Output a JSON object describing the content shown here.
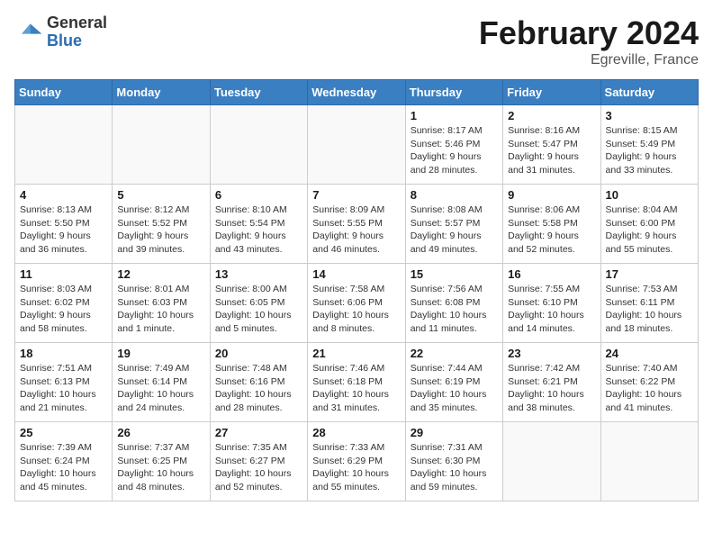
{
  "header": {
    "logo_line1": "General",
    "logo_line2": "Blue",
    "month_year": "February 2024",
    "location": "Egreville, France"
  },
  "days_of_week": [
    "Sunday",
    "Monday",
    "Tuesday",
    "Wednesday",
    "Thursday",
    "Friday",
    "Saturday"
  ],
  "weeks": [
    [
      {
        "day": "",
        "info": ""
      },
      {
        "day": "",
        "info": ""
      },
      {
        "day": "",
        "info": ""
      },
      {
        "day": "",
        "info": ""
      },
      {
        "day": "1",
        "info": "Sunrise: 8:17 AM\nSunset: 5:46 PM\nDaylight: 9 hours and 28 minutes."
      },
      {
        "day": "2",
        "info": "Sunrise: 8:16 AM\nSunset: 5:47 PM\nDaylight: 9 hours and 31 minutes."
      },
      {
        "day": "3",
        "info": "Sunrise: 8:15 AM\nSunset: 5:49 PM\nDaylight: 9 hours and 33 minutes."
      }
    ],
    [
      {
        "day": "4",
        "info": "Sunrise: 8:13 AM\nSunset: 5:50 PM\nDaylight: 9 hours and 36 minutes."
      },
      {
        "day": "5",
        "info": "Sunrise: 8:12 AM\nSunset: 5:52 PM\nDaylight: 9 hours and 39 minutes."
      },
      {
        "day": "6",
        "info": "Sunrise: 8:10 AM\nSunset: 5:54 PM\nDaylight: 9 hours and 43 minutes."
      },
      {
        "day": "7",
        "info": "Sunrise: 8:09 AM\nSunset: 5:55 PM\nDaylight: 9 hours and 46 minutes."
      },
      {
        "day": "8",
        "info": "Sunrise: 8:08 AM\nSunset: 5:57 PM\nDaylight: 9 hours and 49 minutes."
      },
      {
        "day": "9",
        "info": "Sunrise: 8:06 AM\nSunset: 5:58 PM\nDaylight: 9 hours and 52 minutes."
      },
      {
        "day": "10",
        "info": "Sunrise: 8:04 AM\nSunset: 6:00 PM\nDaylight: 9 hours and 55 minutes."
      }
    ],
    [
      {
        "day": "11",
        "info": "Sunrise: 8:03 AM\nSunset: 6:02 PM\nDaylight: 9 hours and 58 minutes."
      },
      {
        "day": "12",
        "info": "Sunrise: 8:01 AM\nSunset: 6:03 PM\nDaylight: 10 hours and 1 minute."
      },
      {
        "day": "13",
        "info": "Sunrise: 8:00 AM\nSunset: 6:05 PM\nDaylight: 10 hours and 5 minutes."
      },
      {
        "day": "14",
        "info": "Sunrise: 7:58 AM\nSunset: 6:06 PM\nDaylight: 10 hours and 8 minutes."
      },
      {
        "day": "15",
        "info": "Sunrise: 7:56 AM\nSunset: 6:08 PM\nDaylight: 10 hours and 11 minutes."
      },
      {
        "day": "16",
        "info": "Sunrise: 7:55 AM\nSunset: 6:10 PM\nDaylight: 10 hours and 14 minutes."
      },
      {
        "day": "17",
        "info": "Sunrise: 7:53 AM\nSunset: 6:11 PM\nDaylight: 10 hours and 18 minutes."
      }
    ],
    [
      {
        "day": "18",
        "info": "Sunrise: 7:51 AM\nSunset: 6:13 PM\nDaylight: 10 hours and 21 minutes."
      },
      {
        "day": "19",
        "info": "Sunrise: 7:49 AM\nSunset: 6:14 PM\nDaylight: 10 hours and 24 minutes."
      },
      {
        "day": "20",
        "info": "Sunrise: 7:48 AM\nSunset: 6:16 PM\nDaylight: 10 hours and 28 minutes."
      },
      {
        "day": "21",
        "info": "Sunrise: 7:46 AM\nSunset: 6:18 PM\nDaylight: 10 hours and 31 minutes."
      },
      {
        "day": "22",
        "info": "Sunrise: 7:44 AM\nSunset: 6:19 PM\nDaylight: 10 hours and 35 minutes."
      },
      {
        "day": "23",
        "info": "Sunrise: 7:42 AM\nSunset: 6:21 PM\nDaylight: 10 hours and 38 minutes."
      },
      {
        "day": "24",
        "info": "Sunrise: 7:40 AM\nSunset: 6:22 PM\nDaylight: 10 hours and 41 minutes."
      }
    ],
    [
      {
        "day": "25",
        "info": "Sunrise: 7:39 AM\nSunset: 6:24 PM\nDaylight: 10 hours and 45 minutes."
      },
      {
        "day": "26",
        "info": "Sunrise: 7:37 AM\nSunset: 6:25 PM\nDaylight: 10 hours and 48 minutes."
      },
      {
        "day": "27",
        "info": "Sunrise: 7:35 AM\nSunset: 6:27 PM\nDaylight: 10 hours and 52 minutes."
      },
      {
        "day": "28",
        "info": "Sunrise: 7:33 AM\nSunset: 6:29 PM\nDaylight: 10 hours and 55 minutes."
      },
      {
        "day": "29",
        "info": "Sunrise: 7:31 AM\nSunset: 6:30 PM\nDaylight: 10 hours and 59 minutes."
      },
      {
        "day": "",
        "info": ""
      },
      {
        "day": "",
        "info": ""
      }
    ]
  ]
}
